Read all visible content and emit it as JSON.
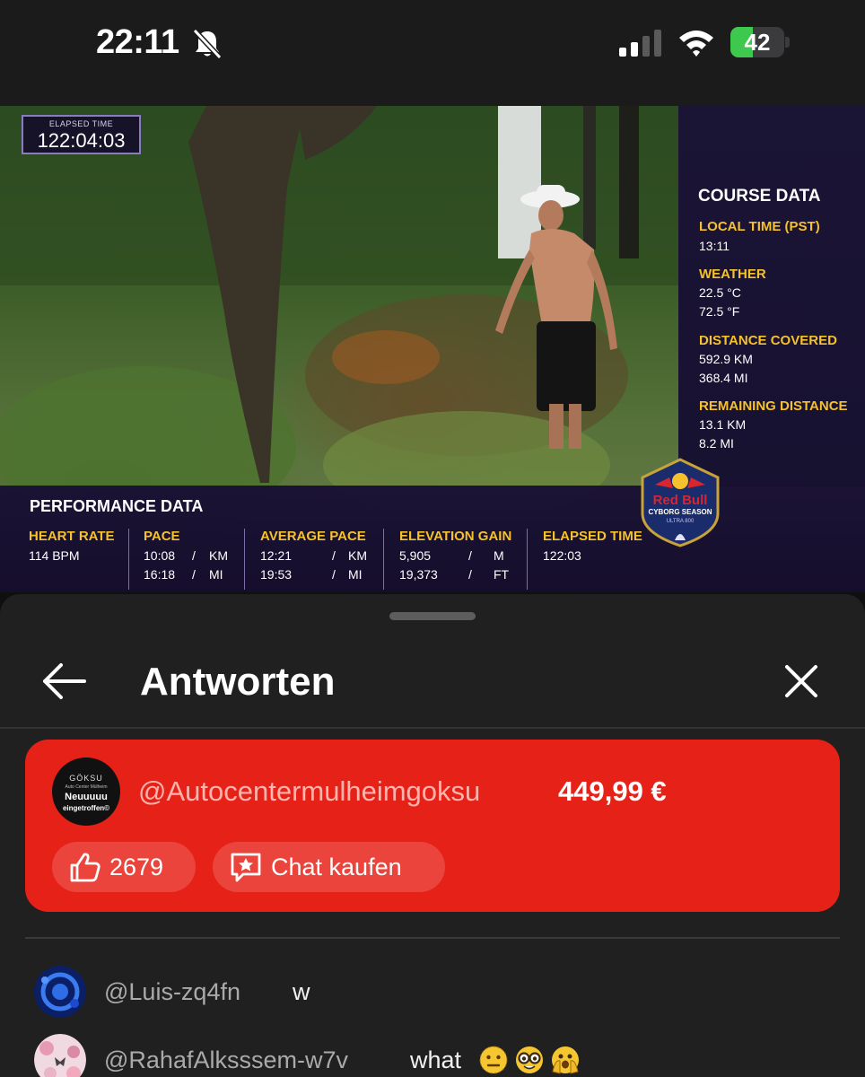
{
  "status_bar": {
    "time": "22:11",
    "battery_percent": "42",
    "battery_level": 0.42,
    "icons": [
      "bell-slash-icon",
      "cellular-signal-icon",
      "wifi-icon",
      "battery-charging-icon"
    ]
  },
  "video": {
    "elapsed_box": {
      "title": "ELAPSED TIME",
      "value": "122:04:03"
    },
    "course": {
      "title": "COURSE DATA",
      "local_time_label": "LOCAL TIME (PST)",
      "local_time": "13:11",
      "weather_label": "WEATHER",
      "weather_c": "22.5 °C",
      "weather_f": "72.5 °F",
      "distance_covered_label": "DISTANCE COVERED",
      "distance_covered_km": "592.9 KM",
      "distance_covered_mi": "368.4 MI",
      "remaining_label": "REMAINING DISTANCE",
      "remaining_km": "13.1 KM",
      "remaining_mi": "8.2 MI"
    },
    "performance": {
      "title": "PERFORMANCE DATA",
      "heart_rate_label": "HEART RATE",
      "heart_rate": "114 BPM",
      "pace_label": "PACE",
      "pace_km": "10:08",
      "pace_mi": "16:18",
      "avg_pace_label": "AVERAGE PACE",
      "avg_pace_km": "12:21",
      "avg_pace_mi": "19:53",
      "elevation_label": "ELEVATION GAIN",
      "elevation_m": "5,905",
      "elevation_ft": "19,373",
      "elapsed_label": "ELAPSED TIME",
      "elapsed": "122:03",
      "unit_sep": "/",
      "unit_km": "KM",
      "unit_mi": "MI",
      "unit_m": "M",
      "unit_ft": "FT"
    },
    "badge": {
      "brand": "Red Bull",
      "line1": "CYBORG SEASON",
      "line2": "ULTRA 800"
    }
  },
  "sheet": {
    "title": "Antworten",
    "superchat": {
      "avatar_brand": "GÖKSU",
      "avatar_sub": "Auto Center Mülheim",
      "avatar_line1": "Neuuuuu",
      "avatar_line2": "eingetroffen©",
      "username": "@Autocentermulheimgoksu",
      "amount": "449,99 €",
      "likes": "2679",
      "chat_button": "Chat kaufen",
      "color": "#e62117"
    },
    "comments": [
      {
        "user": "@Luis-zq4fn",
        "text": "w"
      },
      {
        "user": "@RahafAlksssem-w7v",
        "text": "what",
        "emojis": [
          "neutral-face-icon",
          "nerd-face-icon",
          "face-with-peeking-eye-icon"
        ]
      }
    ]
  }
}
